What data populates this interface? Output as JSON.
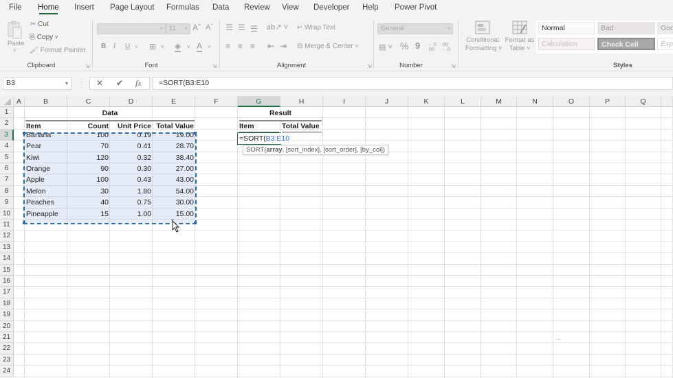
{
  "ribbon_tabs": [
    {
      "label": "File",
      "active": false
    },
    {
      "label": "Home",
      "active": true
    },
    {
      "label": "Insert",
      "active": false
    },
    {
      "label": "Page Layout",
      "active": false
    },
    {
      "label": "Formulas",
      "active": false
    },
    {
      "label": "Data",
      "active": false
    },
    {
      "label": "Review",
      "active": false
    },
    {
      "label": "View",
      "active": false
    },
    {
      "label": "Developer",
      "active": false
    },
    {
      "label": "Help",
      "active": false
    },
    {
      "label": "Power Pivot",
      "active": false
    }
  ],
  "clipboard": {
    "label": "Clipboard",
    "paste": "Paste",
    "cut": "Cut",
    "copy": "Copy",
    "format_painter": "Format Painter"
  },
  "font": {
    "label": "Font",
    "font_name": "",
    "font_size": "11",
    "increase": "Aˆ",
    "decrease": "Aˇ",
    "bold": "B",
    "italic": "I",
    "underline": "U"
  },
  "alignment": {
    "label": "Alignment",
    "wrap_text": "Wrap Text",
    "merge_center": "Merge & Center"
  },
  "number": {
    "label": "Number",
    "format": "General",
    "percent": "%",
    "comma": "9",
    "inc_decimal": "←.0 .00",
    "dec_decimal": ".00 →.0"
  },
  "styles": {
    "label": "Styles",
    "conditional_formatting": [
      "Conditional",
      "Formatting ˅"
    ],
    "format_as_table": [
      "Format as",
      "Table ˅"
    ],
    "cells": [
      {
        "label": "Normal",
        "bg": "#ffffff",
        "fg": "#333333"
      },
      {
        "label": "Bad",
        "bg": "#e8e4e6",
        "fg": "#999999"
      },
      {
        "label": "Goo",
        "bg": "#eceaea",
        "fg": "#999999"
      },
      {
        "label": "Calculation",
        "bg": "#f6f2f4",
        "fg": "#cbbcc7"
      },
      {
        "label": "Check Cell",
        "bg": "#a7a7a7",
        "fg": "#ececec"
      },
      {
        "label": "Exp",
        "bg": "#ffffff",
        "fg": "#bbbbbb"
      }
    ]
  },
  "formula_bar": {
    "name_box": "B3",
    "cancel": "✕",
    "enter": "✔",
    "fx": "fx",
    "formula": "=SORT(B3:E10"
  },
  "columns": [
    "A",
    "B",
    "C",
    "D",
    "E",
    "F",
    "G",
    "H",
    "I",
    "J",
    "K",
    "L",
    "M",
    "N",
    "O",
    "P",
    "Q"
  ],
  "rows": [
    "1",
    "2",
    "3",
    "4",
    "5",
    "6",
    "7",
    "8",
    "9",
    "10",
    "11",
    "12",
    "13",
    "14",
    "15",
    "16",
    "17",
    "18",
    "19",
    "20",
    "21",
    "22",
    "23",
    "24"
  ],
  "data_table": {
    "title": "Data",
    "headers": [
      "Item",
      "Count",
      "Unit Price",
      "Total Value"
    ],
    "rows": [
      [
        "Banana",
        "100",
        "0.19",
        "19.00"
      ],
      [
        "Pear",
        "70",
        "0.41",
        "28.70"
      ],
      [
        "Kiwi",
        "120",
        "0.32",
        "38.40"
      ],
      [
        "Orange",
        "90",
        "0.30",
        "27.00"
      ],
      [
        "Apple",
        "100",
        "0.43",
        "43.00"
      ],
      [
        "Melon",
        "30",
        "1.80",
        "54.00"
      ],
      [
        "Peaches",
        "40",
        "0.75",
        "30.00"
      ],
      [
        "Pineapple",
        "15",
        "1.00",
        "15.00"
      ]
    ]
  },
  "result_table": {
    "title": "Result",
    "headers": [
      "Item",
      "Total Value"
    ],
    "editing_prefix": "=SORT(",
    "editing_ref": "B3:E10",
    "tooltip_fn": "SORT(",
    "tooltip_bold": "array",
    "tooltip_rest": ", [sort_index], [sort_order], [by_col])"
  },
  "stray_mark": "....",
  "colors": {
    "accent_green": "#217346",
    "selection_blue": "#2e6da4",
    "reference_blue": "#3a6fc4"
  }
}
